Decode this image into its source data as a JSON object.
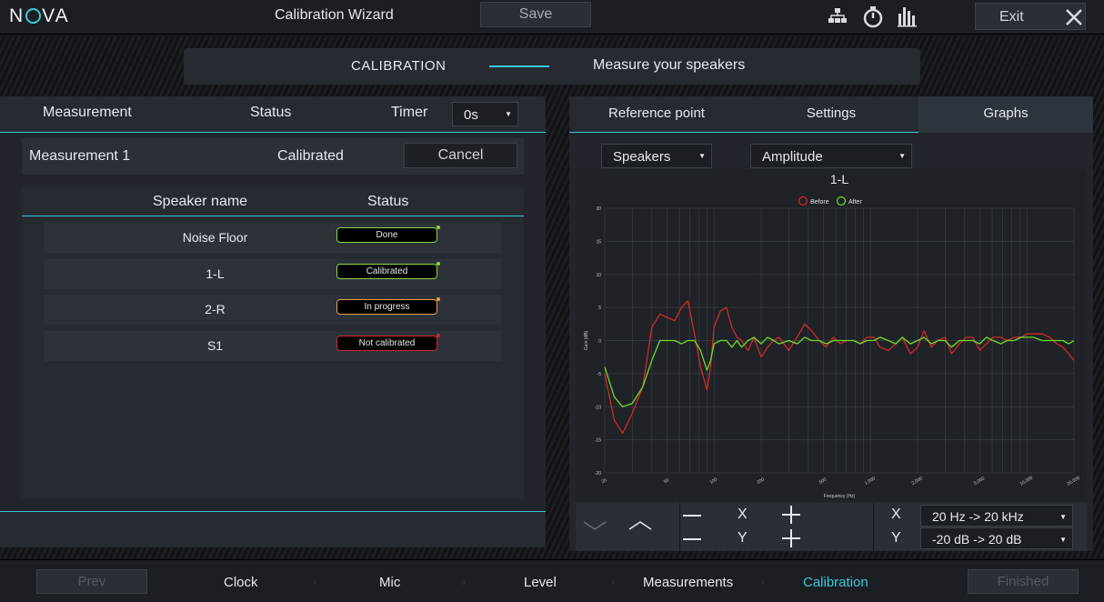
{
  "app": {
    "logo": "NOVA",
    "window_title": "Calibration Wizard",
    "save_label": "Save",
    "exit_label": "Exit"
  },
  "step": {
    "name": "CALIBRATION",
    "description": "Measure your speakers"
  },
  "left": {
    "headers": {
      "measurement": "Measurement",
      "status": "Status",
      "timer": "Timer"
    },
    "timer_value": "0s",
    "measurement": {
      "name": "Measurement 1",
      "status": "Calibrated",
      "cancel_label": "Cancel"
    },
    "speaker_headers": {
      "name": "Speaker name",
      "status": "Status"
    },
    "speakers": [
      {
        "name": "Noise Floor",
        "status": "Done",
        "border": "#8ed44a",
        "dot": "#8ed44a"
      },
      {
        "name": "1-L",
        "status": "Calibrated",
        "border": "#8ed44a",
        "dot": "#8ed44a"
      },
      {
        "name": "2-R",
        "status": "In progress",
        "border": "#e8a24a",
        "dot": "#e8a24a"
      },
      {
        "name": "S1",
        "status": "Not calibrated",
        "border": "#d9242c",
        "dot": "#d9242c"
      }
    ]
  },
  "right": {
    "tabs": [
      "Reference point",
      "Settings",
      "Graphs"
    ],
    "active_tab": "Graphs",
    "dropdown_source": "Speakers",
    "dropdown_mode": "Amplitude",
    "controls": {
      "x_label": "X",
      "y_label": "Y",
      "x_range": "20 Hz -> 20 kHz",
      "y_range": "-20 dB -> 20 dB"
    }
  },
  "chart_data": {
    "type": "line",
    "title": "1-L",
    "xlabel": "Frequency (Hz)",
    "ylabel": "Gain (dB)",
    "x_scale": "log",
    "xlim": [
      20,
      20000
    ],
    "ylim": [
      -20,
      20
    ],
    "grid": true,
    "legend_position": "top-center",
    "x_ticks": [
      20,
      50,
      100,
      200,
      500,
      1000,
      2000,
      5000,
      10000,
      20000
    ],
    "x_tick_labels": [
      "20",
      "50",
      "100",
      "200",
      "500",
      "1,000",
      "2,000",
      "5,000",
      "10,000",
      "20,000"
    ],
    "y_ticks": [
      -20,
      -15,
      -10,
      -5,
      0,
      5,
      10,
      15,
      20
    ],
    "x": [
      20,
      23,
      26,
      30,
      35,
      40,
      45,
      50,
      56,
      62,
      68,
      75,
      82,
      90,
      95,
      100,
      110,
      120,
      130,
      140,
      150,
      165,
      180,
      200,
      220,
      240,
      260,
      300,
      340,
      380,
      420,
      470,
      520,
      580,
      640,
      700,
      780,
      860,
      950,
      1050,
      1150,
      1300,
      1450,
      1600,
      1800,
      2000,
      2200,
      2450,
      2700,
      3000,
      3300,
      3700,
      4100,
      4500,
      5000,
      5500,
      6100,
      6800,
      7500,
      8300,
      9200,
      10000,
      11000,
      12500,
      14000,
      15500,
      17000,
      18500,
      20000
    ],
    "series": [
      {
        "name": "Before",
        "color": "#d12a2a",
        "values": [
          -5,
          -12,
          -14,
          -11,
          -7,
          2,
          4,
          3.5,
          3,
          5,
          6,
          1,
          -4,
          -7.5,
          -4,
          2,
          4.5,
          5,
          2,
          0.5,
          0,
          -1.5,
          0.5,
          -2.5,
          -1,
          0,
          0.5,
          -1.5,
          0.5,
          2.5,
          1.5,
          0,
          -1,
          0.5,
          -0.5,
          0,
          0,
          -0.5,
          0.5,
          0.5,
          -1,
          -1.5,
          -0.5,
          0.5,
          -2,
          -1,
          1.5,
          -1,
          0,
          0.5,
          -2,
          -0.5,
          0.5,
          0.5,
          -1.5,
          -0.5,
          0.5,
          0.5,
          0,
          0.5,
          0.5,
          1,
          1,
          1,
          0.5,
          -0.5,
          -1,
          -2,
          -3
        ]
      },
      {
        "name": "After",
        "color": "#6edc2a",
        "values": [
          -4,
          -8.5,
          -10,
          -9.5,
          -7,
          -3,
          0,
          0,
          0,
          -0.5,
          0,
          0,
          -1.5,
          -4.5,
          -3,
          -0.5,
          0,
          0,
          -1,
          0,
          -1,
          0,
          0.5,
          -0.5,
          0.5,
          0,
          -0.5,
          0,
          -0.5,
          0.5,
          0,
          0,
          -0.5,
          0,
          0,
          0,
          0,
          -0.5,
          0,
          0,
          0.5,
          0,
          -0.5,
          0.5,
          -0.5,
          0,
          0.5,
          -0.5,
          0,
          0,
          -1,
          0,
          0,
          0,
          -0.5,
          0.5,
          0,
          -0.5,
          0,
          0,
          0.5,
          0.5,
          0.5,
          0,
          0,
          0,
          0,
          -0.5,
          0
        ]
      }
    ]
  },
  "nav": {
    "prev_label": "Prev",
    "finished_label": "Finished",
    "steps": [
      "Clock",
      "Mic",
      "Level",
      "Measurements",
      "Calibration"
    ],
    "active_step": "Calibration"
  },
  "colors": {
    "accent": "#3cc7d8",
    "panel": "#22262c",
    "background": "#15181c"
  }
}
